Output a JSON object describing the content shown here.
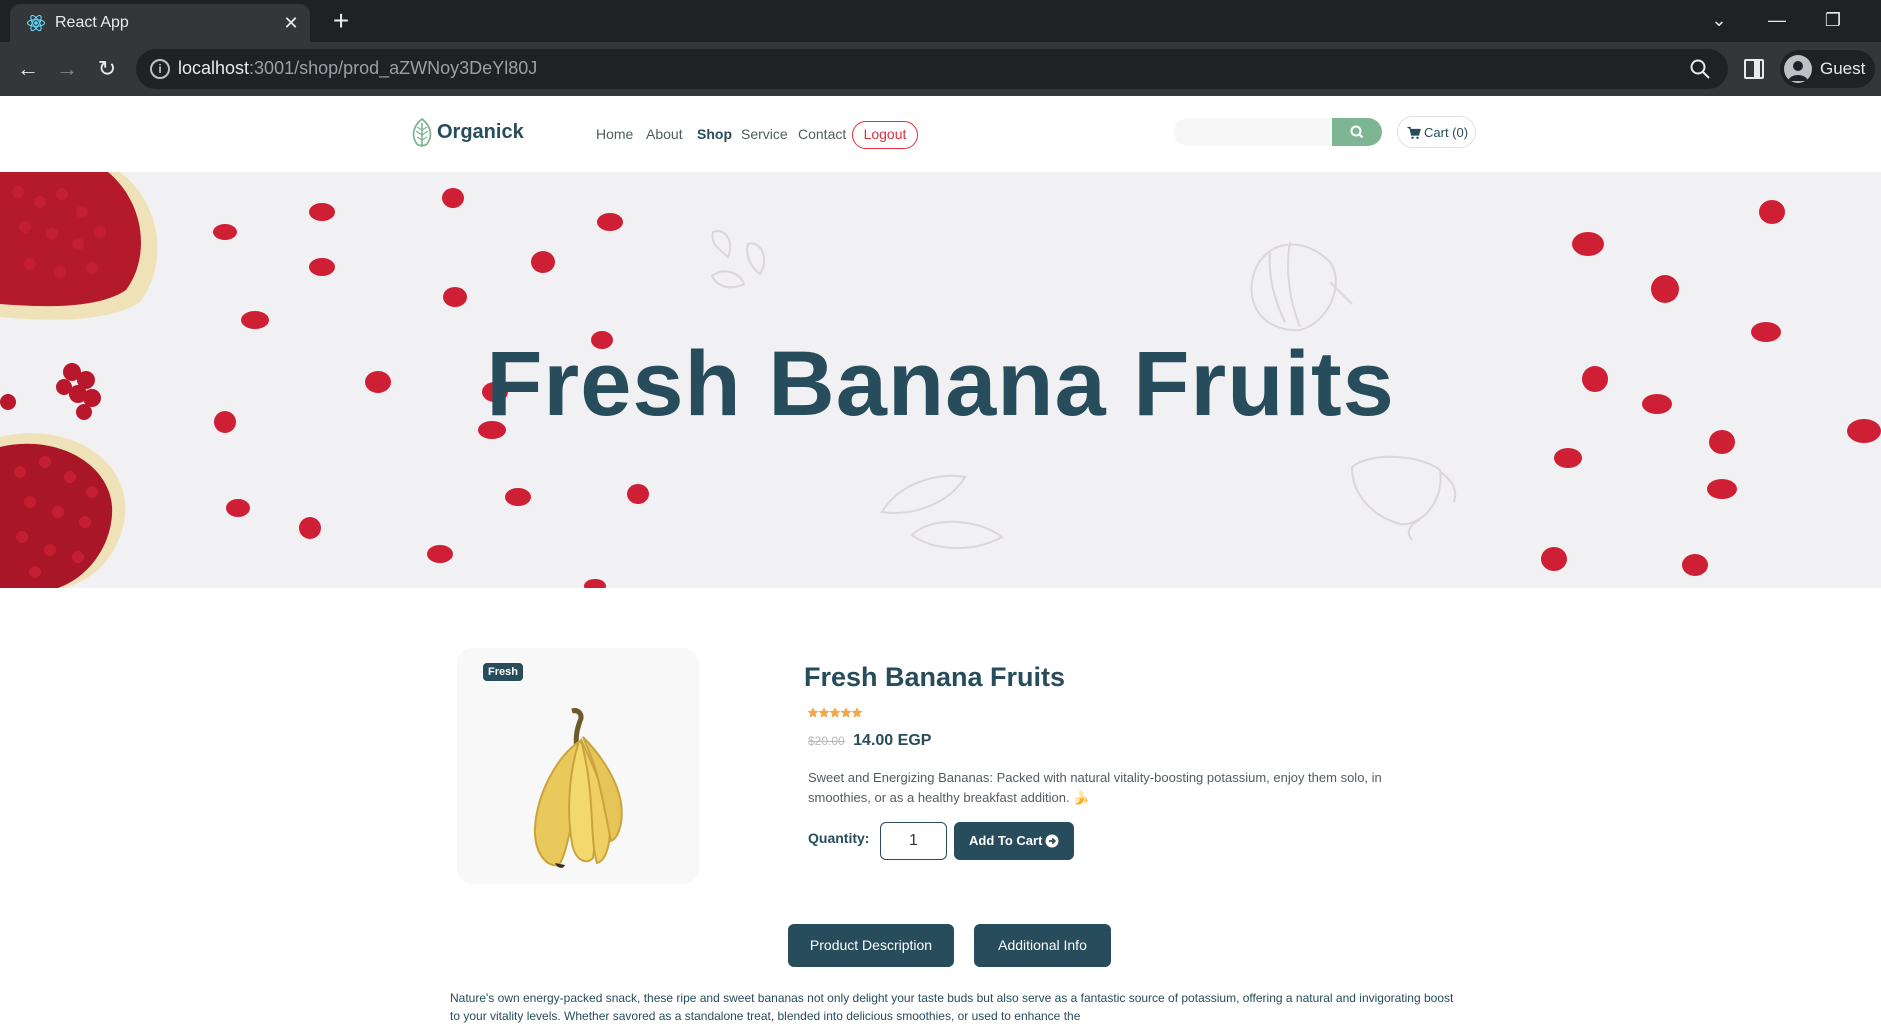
{
  "browser": {
    "tab_title": "React App",
    "url_host": "localhost",
    "url_rest": ":3001/shop/prod_aZWNoy3DeYl80J",
    "profile_name": "Guest"
  },
  "header": {
    "logo_text": "Organick",
    "nav": [
      "Home",
      "About",
      "Shop",
      "Service",
      "Contact"
    ],
    "active_nav": "Shop",
    "logout_label": "Logout",
    "search_placeholder": "",
    "cart_label": "Cart (0)"
  },
  "hero": {
    "title": "Fresh Banana Fruits"
  },
  "product": {
    "badge": "Fresh",
    "title": "Fresh Banana Fruits",
    "rating": 5,
    "old_price": "$20.00",
    "price": "14.00 EGP",
    "description": "Sweet and Energizing Bananas: Packed with natural vitality-boosting potassium, enjoy them solo, in smoothies, or as a healthy breakfast addition. 🍌",
    "quantity_label": "Quantity:",
    "quantity_value": "1",
    "add_to_cart_label": "Add To Cart"
  },
  "tabs": {
    "description_label": "Product Description",
    "additional_label": "Additional Info"
  },
  "long_description": "Nature's own energy-packed snack, these ripe and sweet bananas not only delight your taste buds but also serve as a fantastic source of potassium, offering a natural and invigorating boost to your vitality levels. Whether savored as a standalone treat, blended into delicious smoothies, or used to enhance the",
  "colors": {
    "brand": "#274c5b",
    "accent": "#7eb693",
    "logout": "#e0303c",
    "star": "#f4a64a"
  },
  "icons": {
    "search": "search-icon",
    "cart": "cart-icon",
    "add_to_cart": "arrow-circle-right-icon"
  }
}
